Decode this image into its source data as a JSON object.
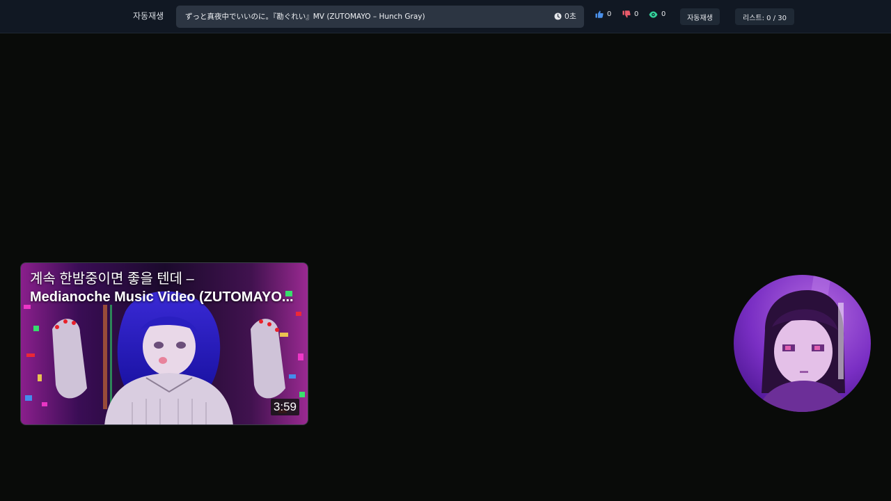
{
  "header": {
    "autoplay_label": "자동재생",
    "now_playing_title": "ずっと真夜中でいいのに。『勘ぐれい』MV (ZUTOMAYO – Hunch Gray)",
    "elapsed": "0초",
    "likes": "0",
    "dislikes": "0",
    "views": "0",
    "autoplay_button": "자동재생",
    "playlist_counter": "리스트: 0 / 30"
  },
  "video_card": {
    "title_line1": "계속 한밤중이면 좋을 텐데 –",
    "title_line2": "Medianoche Music Video (ZUTOMAYO...",
    "duration": "3:59"
  },
  "colors": {
    "background": "#090b09",
    "topbar": "#111823",
    "like": "#4a8fe8",
    "dislike": "#e85a6a",
    "views": "#34d39b"
  },
  "icons": {
    "clock": "clock-icon",
    "like": "thumbs-up-icon",
    "dislike": "thumbs-down-icon",
    "views": "eye-icon"
  }
}
